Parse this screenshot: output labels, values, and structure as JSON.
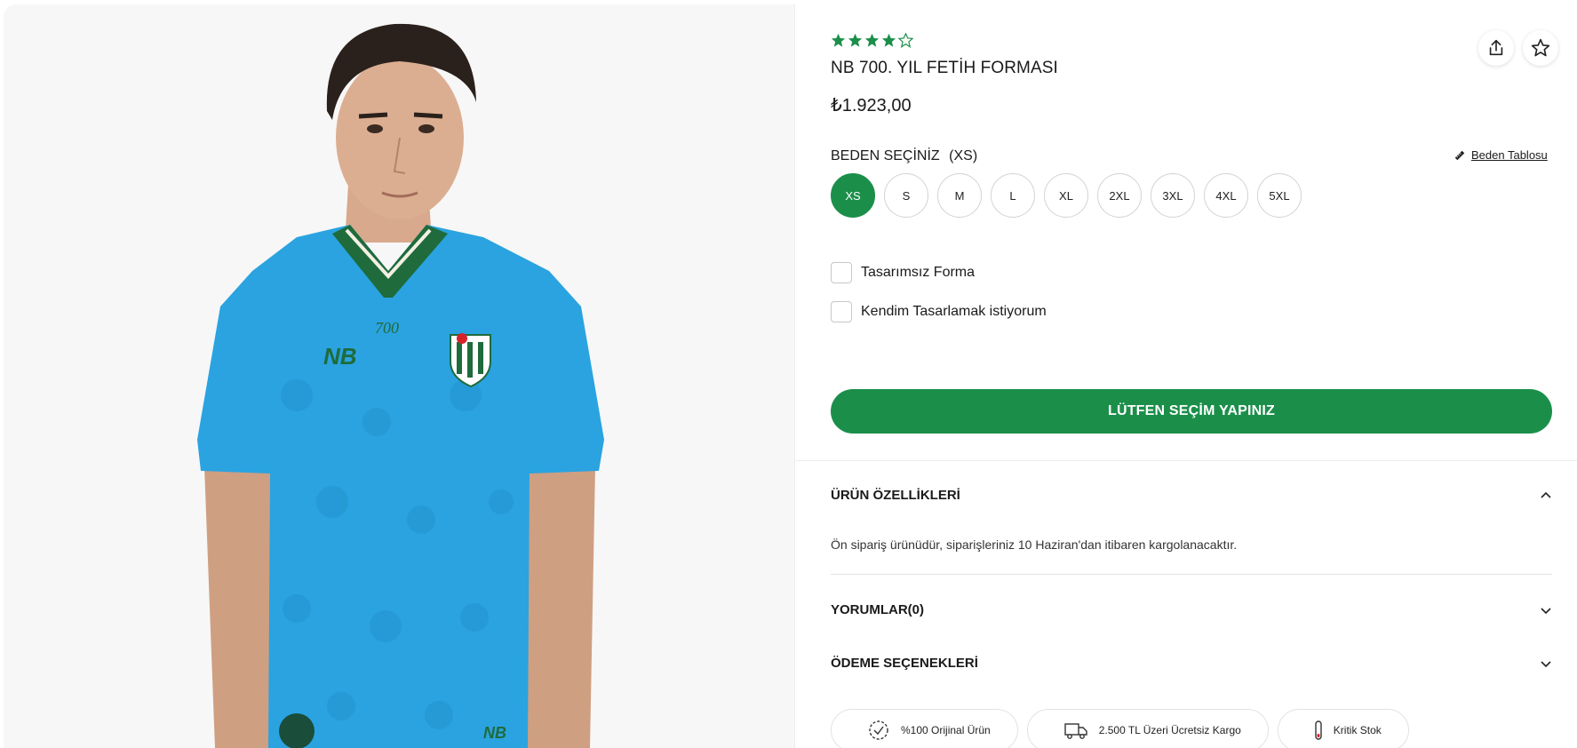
{
  "product": {
    "rating_stars": 4,
    "rating_max": 5,
    "title": "NB 700. YIL FETİH FORMASI",
    "price": "₺1.923,00"
  },
  "actions": {
    "share_icon": "share-icon",
    "favorite_icon": "star-icon"
  },
  "size_selector": {
    "label": "BEDEN SEÇİNİZ",
    "selected_display": "(XS)",
    "size_table_label": "Beden Tablosu",
    "sizes": [
      "XS",
      "S",
      "M",
      "L",
      "XL",
      "2XL",
      "3XL",
      "4XL",
      "5XL"
    ],
    "selected": "XS"
  },
  "options": {
    "no_design": "Tasarımsız Forma",
    "custom_design": "Kendim Tasarlamak istiyorum"
  },
  "cta": {
    "label": "LÜTFEN SEÇİM YAPINIZ"
  },
  "accordion": {
    "features_title": "ÜRÜN ÖZELLİKLERİ",
    "features_body": "Ön sipariş ürünüdür, siparişleriniz 10 Haziran'dan itibaren kargolanacaktır.",
    "reviews_title": "YORUMLAR(0)",
    "payment_title": "ÖDEME SEÇENEKLERİ"
  },
  "badges": {
    "original": "%100 Orijinal Ürün",
    "shipping": "2.500 TL Üzeri Ücretsiz Kargo",
    "stock": "Kritik Stok"
  },
  "colors": {
    "accent_green": "#1b8f4a",
    "jersey_blue": "#2aa3e0",
    "star_green": "#1b8f4a"
  }
}
